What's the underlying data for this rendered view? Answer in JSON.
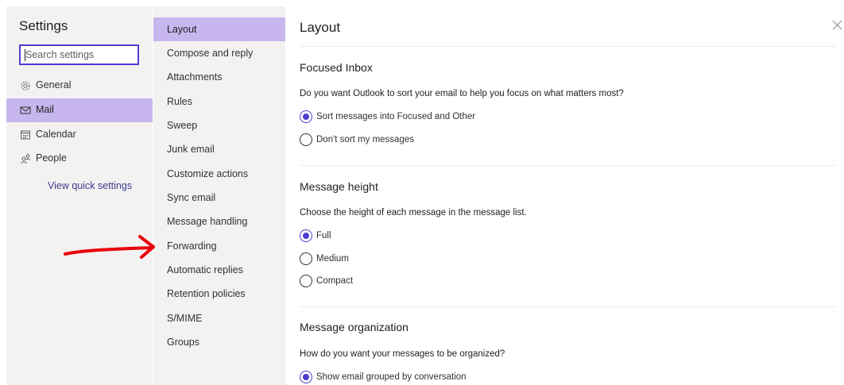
{
  "settings_nav": {
    "title": "Settings",
    "search_placeholder": "Search settings",
    "items": [
      {
        "label": "General",
        "icon": "gear-icon"
      },
      {
        "label": "Mail",
        "icon": "mail-icon"
      },
      {
        "label": "Calendar",
        "icon": "calendar-icon"
      },
      {
        "label": "People",
        "icon": "people-icon"
      }
    ],
    "quick_link": "View quick settings"
  },
  "mail_subnav": {
    "items": [
      "Layout",
      "Compose and reply",
      "Attachments",
      "Rules",
      "Sweep",
      "Junk email",
      "Customize actions",
      "Sync email",
      "Message handling",
      "Forwarding",
      "Automatic replies",
      "Retention policies",
      "S/MIME",
      "Groups"
    ]
  },
  "main": {
    "title": "Layout",
    "sections": [
      {
        "title": "Focused Inbox",
        "question": "Do you want Outlook to sort your email to help you focus on what matters most?",
        "options": [
          "Sort messages into Focused and Other",
          "Don't sort my messages"
        ]
      },
      {
        "title": "Message height",
        "question": "Choose the height of each message in the message list.",
        "options": [
          "Full",
          "Medium",
          "Compact"
        ]
      },
      {
        "title": "Message organization",
        "question": "How do you want your messages to be organized?",
        "options": [
          "Show email grouped by conversation"
        ]
      }
    ]
  },
  "colors": {
    "accent": "#4f3dd1",
    "selected_bg": "#c7b7ee",
    "panel_bg": "#f3f2f1",
    "annotation_arrow": "#e8000b"
  }
}
